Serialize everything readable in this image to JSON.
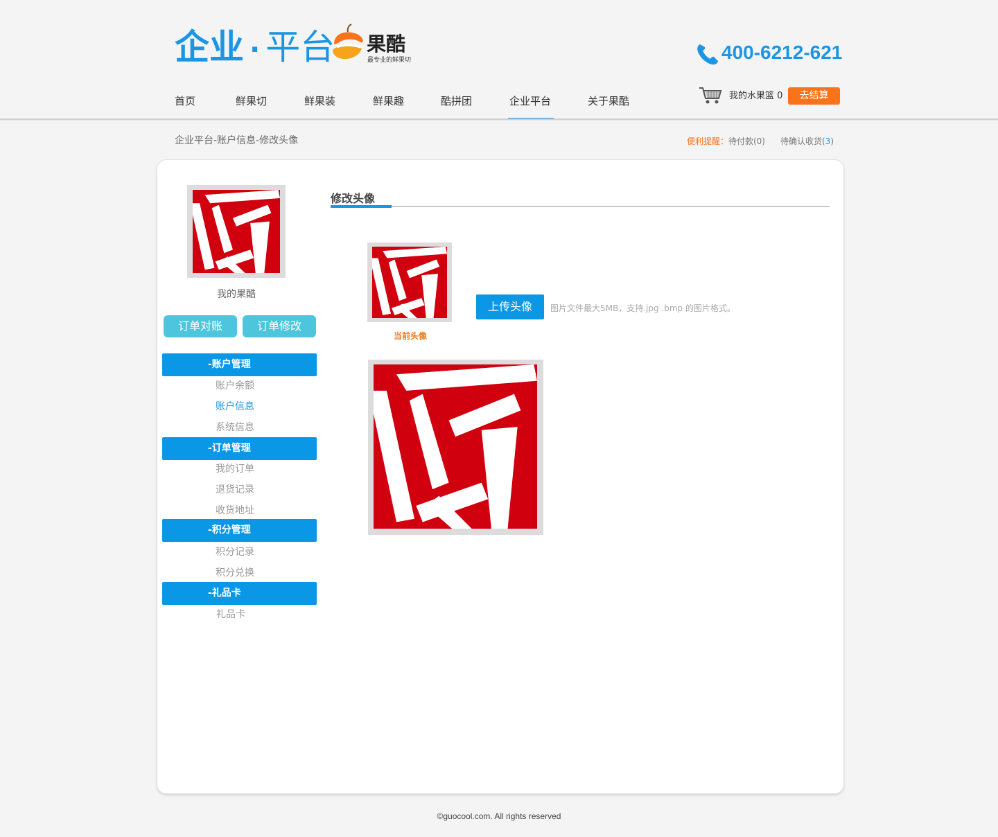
{
  "header": {
    "logo_title_a": "企业",
    "logo_dot": "·",
    "logo_title_b": "平台",
    "brand_name": "果酷",
    "brand_slogan": "最专业的鲜果切",
    "phone": "400-6212-621",
    "accent_color": "#1b96e4"
  },
  "nav": {
    "items": [
      "首页",
      "鲜果切",
      "鲜果装",
      "鲜果趣",
      "酷拼团",
      "企业平台",
      "关于果酷"
    ],
    "active": "企业平台"
  },
  "cart": {
    "label": "我的水果篮",
    "count": "0",
    "checkout_label": "去结算",
    "checkout_color": "#f9731a"
  },
  "breadcrumb": "企业平台-账户信息-修改头像",
  "reminder": {
    "label": "便利提醒：",
    "pending_pay_text": "待付款(",
    "pending_pay_count": "0",
    "pending_receive_text": "待确认收货(",
    "pending_receive_count": "3",
    "close_paren": ")"
  },
  "sidebar": {
    "profile_label": "我的果酷",
    "buttons": [
      "订单对账",
      "订单修改"
    ],
    "sections": [
      {
        "title": "-账户管理",
        "items": [
          "账户余额",
          "账户信息",
          "系统信息"
        ]
      },
      {
        "title": "-订单管理",
        "items": [
          "我的订单",
          "退货记录",
          "收货地址"
        ]
      },
      {
        "title": "-积分管理",
        "items": [
          "积分记录",
          "积分兑换"
        ]
      },
      {
        "title": "-礼品卡",
        "items": [
          "礼品卡"
        ]
      }
    ],
    "current_item": "账户信息"
  },
  "main": {
    "section_title": "修改头像",
    "current_avatar_label": "当前头像",
    "upload_button": "上传头像",
    "upload_hint": "图片文件最大5MB，支持.jpg .bmp 的图片格式。"
  },
  "avatar": {
    "primary_color": "#d0000f",
    "background": "#ffffff"
  },
  "footer": "©guocool.com. All rights reserved"
}
